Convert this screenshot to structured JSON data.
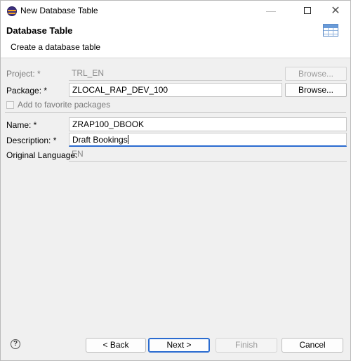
{
  "window": {
    "title": "New Database Table"
  },
  "banner": {
    "title": "Database Table",
    "subtitle": "Create a database table",
    "icon": "table-icon"
  },
  "form": {
    "project": {
      "label": "Project: *",
      "value": "TRL_EN",
      "browse": "Browse..."
    },
    "package": {
      "label": "Package: *",
      "value": "ZLOCAL_RAP_DEV_100",
      "browse": "Browse..."
    },
    "favorite": {
      "label": "Add to favorite packages"
    },
    "name": {
      "label": "Name: *",
      "value": "ZRAP100_DBOOK"
    },
    "description": {
      "label": "Description: *",
      "value": "Draft Bookings"
    },
    "language": {
      "label": "Original Language:",
      "value": "EN"
    }
  },
  "buttons": {
    "back": "< Back",
    "next": "Next >",
    "finish": "Finish",
    "cancel": "Cancel"
  },
  "colors": {
    "focus": "#2a6bd0",
    "banner_icon": "#6a9bd8"
  }
}
